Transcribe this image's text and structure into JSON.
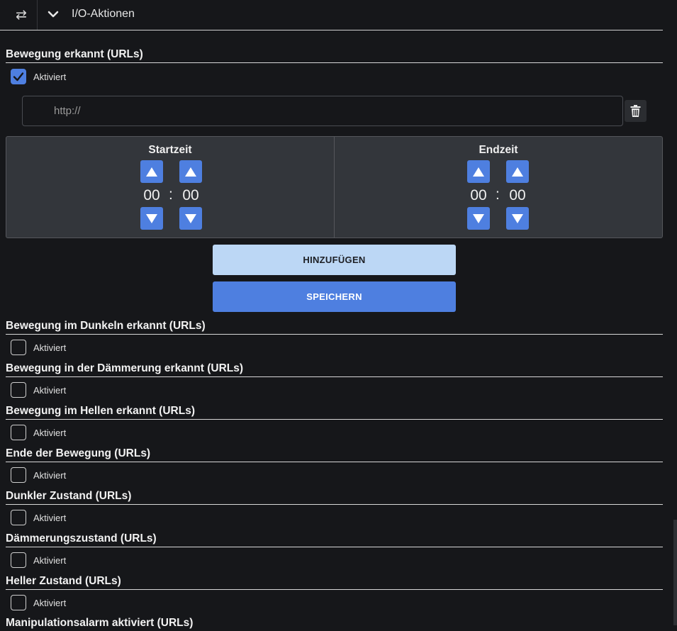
{
  "header": {
    "swap_icon": "swap-arrows-icon",
    "collapse_icon": "chevron-down-icon",
    "title": "I/O-Aktionen"
  },
  "motion_section": {
    "title": "Bewegung erkannt (URLs)",
    "enabled_label": "Aktiviert",
    "enabled": true,
    "url_placeholder": "http://",
    "url_value": "",
    "delete_icon": "trash-icon"
  },
  "schedule": {
    "start": {
      "label": "Startzeit",
      "hours": "00",
      "minutes": "00"
    },
    "end": {
      "label": "Endzeit",
      "hours": "00",
      "minutes": "00"
    },
    "separator": ":"
  },
  "buttons": {
    "add": "HINZUFÜGEN",
    "save": "SPEICHERN"
  },
  "sections": [
    {
      "title": "Bewegung im Dunkeln erkannt (URLs)",
      "label": "Aktiviert",
      "checked": false
    },
    {
      "title": "Bewegung in der Dämmerung erkannt (URLs)",
      "label": "Aktiviert",
      "checked": false
    },
    {
      "title": "Bewegung im Hellen erkannt (URLs)",
      "label": "Aktiviert",
      "checked": false
    },
    {
      "title": "Ende der Bewegung (URLs)",
      "label": "Aktiviert",
      "checked": false
    },
    {
      "title": "Dunkler Zustand (URLs)",
      "label": "Aktiviert",
      "checked": false
    },
    {
      "title": "Dämmerungszustand (URLs)",
      "label": "Aktiviert",
      "checked": false
    },
    {
      "title": "Heller Zustand (URLs)",
      "label": "Aktiviert",
      "checked": false
    },
    {
      "title": "Manipulationsalarm aktiviert (URLs)"
    }
  ],
  "colors": {
    "accent": "#4e7fe0",
    "accent_light": "#bcd7f5",
    "background": "#16171a",
    "panel": "#33363b"
  }
}
